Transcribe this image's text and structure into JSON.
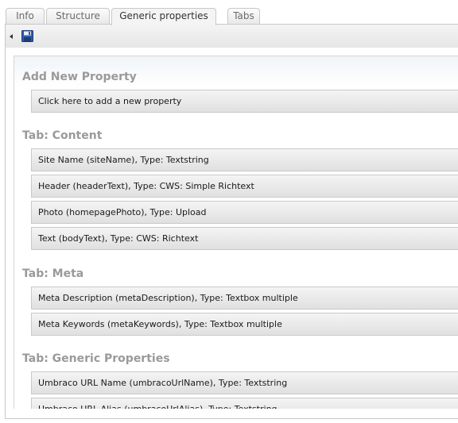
{
  "tabs": [
    {
      "label": "Info"
    },
    {
      "label": "Structure"
    },
    {
      "label": "Generic properties"
    },
    {
      "label": "Tabs"
    }
  ],
  "toolbar": {
    "back_icon": "arrow-left-icon",
    "save_icon": "floppy-disk-icon"
  },
  "add_section": {
    "title": "Add New Property",
    "row_label": "Click here to add a new property"
  },
  "groups": [
    {
      "title": "Tab: Content",
      "properties": [
        "Site Name (siteName), Type: Textstring",
        "Header (headerText), Type: CWS: Simple Richtext",
        "Photo (homepagePhoto), Type: Upload",
        "Text (bodyText), Type: CWS: Richtext"
      ]
    },
    {
      "title": "Tab: Meta",
      "properties": [
        "Meta Description (metaDescription), Type: Textbox multiple",
        "Meta Keywords (metaKeywords), Type: Textbox multiple"
      ]
    },
    {
      "title": "Tab: Generic Properties",
      "properties": [
        "Umbraco URL Name (umbracoUrlName), Type: Textstring",
        "Umbraco URL Alias (umbracoUrlAlias), Type: Textstring"
      ]
    }
  ]
}
